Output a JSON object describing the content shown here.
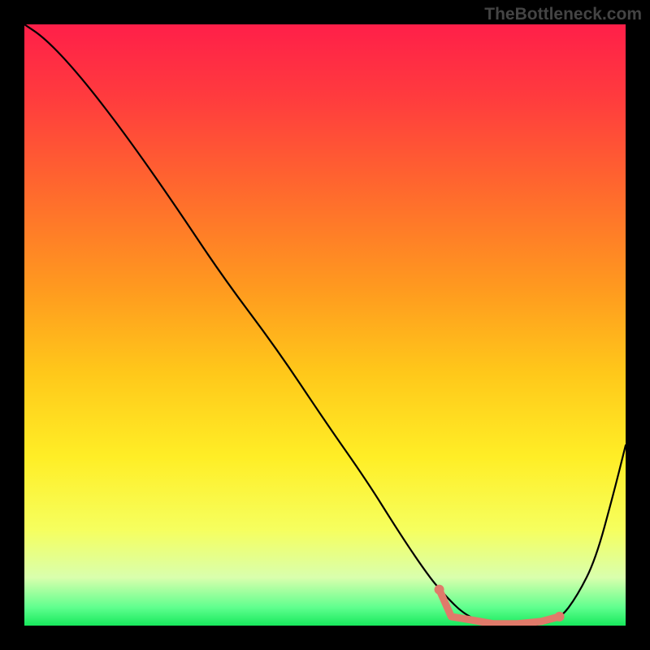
{
  "watermark": "TheBottleneck.com",
  "accent_salmon": "#e07a6a",
  "gradient_stops": [
    {
      "offset": 0.0,
      "color": "#ff1f49"
    },
    {
      "offset": 0.12,
      "color": "#ff3b3e"
    },
    {
      "offset": 0.28,
      "color": "#ff6a2d"
    },
    {
      "offset": 0.44,
      "color": "#ff9a1f"
    },
    {
      "offset": 0.58,
      "color": "#ffc81a"
    },
    {
      "offset": 0.72,
      "color": "#ffee26"
    },
    {
      "offset": 0.84,
      "color": "#f6ff5e"
    },
    {
      "offset": 0.92,
      "color": "#d9ffad"
    },
    {
      "offset": 0.97,
      "color": "#5fff8e"
    },
    {
      "offset": 1.0,
      "color": "#17e85c"
    }
  ],
  "chart_data": {
    "type": "line",
    "title": "",
    "xlabel": "",
    "ylabel": "",
    "xlim": [
      0,
      100
    ],
    "ylim": [
      0,
      100
    ],
    "series": [
      {
        "name": "curve",
        "x": [
          0,
          3,
          7,
          12,
          18,
          25,
          33,
          42,
          50,
          57,
          62,
          66,
          69,
          74,
          80,
          85,
          89,
          92,
          95,
          98,
          100
        ],
        "y": [
          100,
          98,
          94,
          88,
          80,
          70,
          58,
          46,
          34,
          24,
          16,
          10,
          6,
          1,
          0,
          0,
          1,
          5,
          11,
          22,
          30
        ]
      }
    ],
    "highlight_band": {
      "x_start": 69,
      "x_end": 89,
      "y_approx": 0.5,
      "color": "#e07a6a",
      "dots": [
        {
          "x": 69,
          "y": 6
        },
        {
          "x": 71,
          "y": 1.5
        },
        {
          "x": 74,
          "y": 1
        },
        {
          "x": 78,
          "y": 0.3
        },
        {
          "x": 82,
          "y": 0.3
        },
        {
          "x": 86,
          "y": 0.7
        },
        {
          "x": 89,
          "y": 1.5
        }
      ]
    }
  }
}
